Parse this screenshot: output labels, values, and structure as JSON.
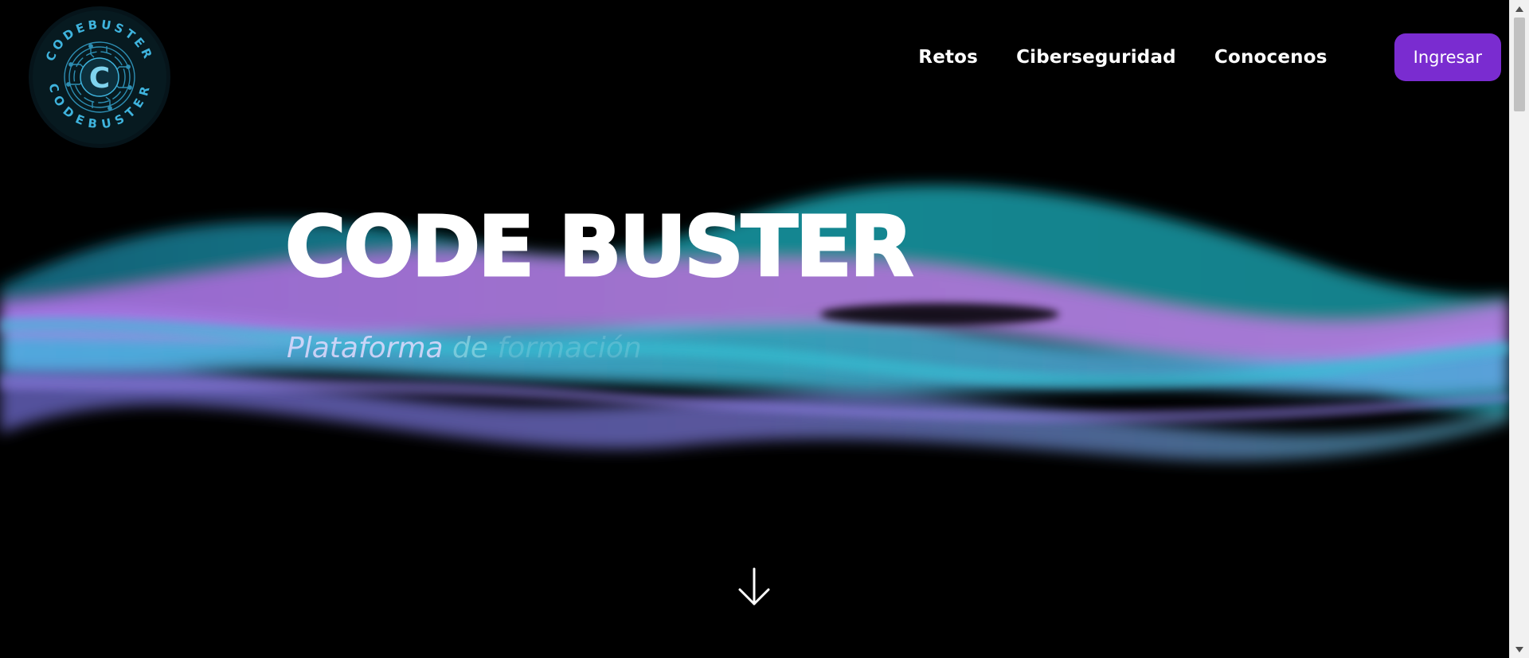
{
  "brand": {
    "logo_ring_top_text": "CODEBUSTER",
    "logo_ring_bottom_text": "CODEBUSTER",
    "logo_letter": "C",
    "logo_icon": "circuit-badge-logo"
  },
  "nav": {
    "links": [
      "Retos",
      "Ciberseguridad",
      "Conocenos"
    ],
    "cta_label": "Ingresar"
  },
  "hero": {
    "title": "CODE BUSTER",
    "subtitle_words": [
      "Plataforma",
      "de",
      "formación"
    ],
    "scroll_icon": "arrow-down-icon"
  },
  "colors": {
    "background": "#000000",
    "accent_purple": "#7a2cd0",
    "logo_cyan": "#3fb4de",
    "wave_teal": "#1fa5b5",
    "wave_pink": "#c06ee0",
    "wave_blue": "#5aa8e8",
    "wave_violet": "#7b6fd6"
  }
}
